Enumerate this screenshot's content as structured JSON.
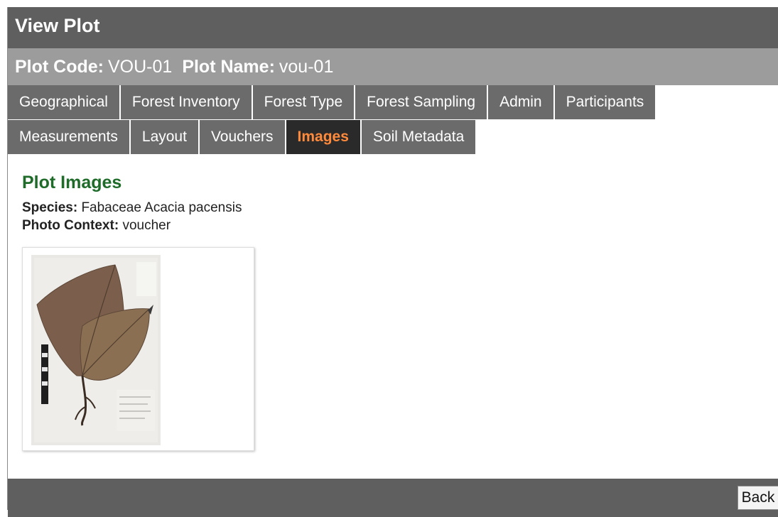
{
  "title": "View Plot",
  "plot": {
    "code_label": "Plot Code:",
    "code_value": "VOU-01",
    "name_label": "Plot Name:",
    "name_value": "vou-01"
  },
  "tabs_row1": [
    {
      "label": "Geographical"
    },
    {
      "label": "Forest Inventory"
    },
    {
      "label": "Forest Type"
    },
    {
      "label": "Forest Sampling"
    },
    {
      "label": "Admin"
    },
    {
      "label": "Participants"
    }
  ],
  "tabs_row2": [
    {
      "label": "Measurements"
    },
    {
      "label": "Layout"
    },
    {
      "label": "Vouchers"
    },
    {
      "label": "Images",
      "active": true
    },
    {
      "label": "Soil Metadata"
    }
  ],
  "section": {
    "title": "Plot Images",
    "species_label": "Species:",
    "species_value": "Fabaceae Acacia pacensis",
    "context_label": "Photo Context:",
    "context_value": "voucher"
  },
  "footer": {
    "back_label": "Back"
  },
  "colors": {
    "title_bar": "#5f5f5f",
    "code_bar": "#9c9c9c",
    "tab": "#6b6b6b",
    "tab_active": "#2a2a2a",
    "tab_active_text": "#ff8a3c",
    "section_title": "#1e6b2a"
  }
}
